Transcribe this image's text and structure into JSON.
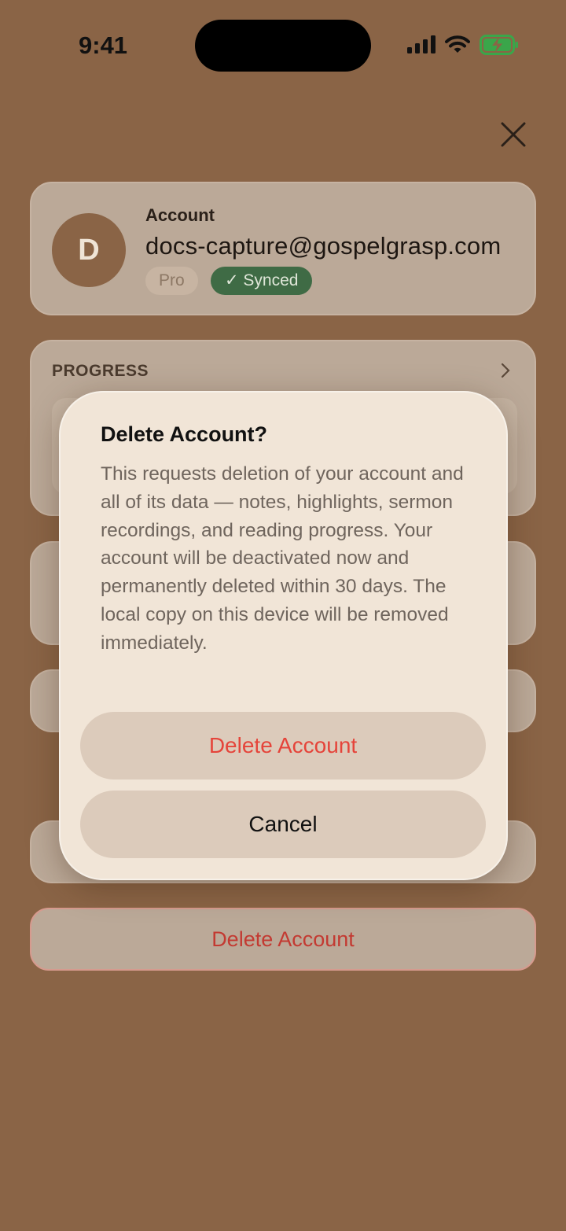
{
  "status_bar": {
    "time": "9:41"
  },
  "account": {
    "avatar_initial": "D",
    "label": "Account",
    "email": "docs-capture@gospelgrasp.com",
    "badge_pro": "Pro",
    "badge_synced": "✓ Synced"
  },
  "progress": {
    "label": "PROGRESS"
  },
  "background_delete_label": "Delete Account",
  "dialog": {
    "title": "Delete Account?",
    "message": "This requests deletion of your account and all of its data — notes, highlights, sermon recordings, and reading progress. Your account will be deactivated now and permanently deleted within 30 days. The local copy on this device will be removed immediately.",
    "delete_label": "Delete Account",
    "cancel_label": "Cancel"
  },
  "colors": {
    "background": "#8a6446",
    "destructive": "#e5443a",
    "synced_badge": "#3f6b45"
  }
}
